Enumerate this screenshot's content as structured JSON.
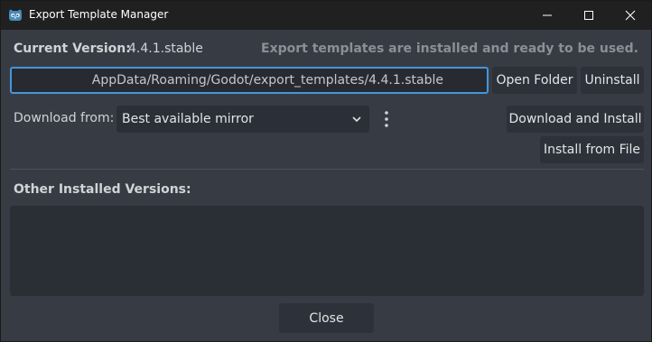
{
  "window": {
    "title": "Export Template Manager",
    "icons": {
      "app": "godot-icon",
      "minimize": "minimize-icon",
      "maximize": "maximize-icon",
      "close": "close-icon"
    }
  },
  "current": {
    "label": "Current Version:",
    "value": "4.4.1.stable",
    "status": "Export templates are installed and ready to be used."
  },
  "path": {
    "value": "AppData/Roaming/Godot/export_templates/4.4.1.stable"
  },
  "buttons": {
    "open_folder": "Open Folder",
    "uninstall": "Uninstall",
    "download_install": "Download and Install",
    "install_from_file": "Install from File",
    "close": "Close"
  },
  "download": {
    "label": "Download from:",
    "selected": "Best available mirror"
  },
  "other": {
    "label": "Other Installed Versions:",
    "items": []
  },
  "colors": {
    "accent": "#4596db",
    "background": "#373c44",
    "field": "#272b31"
  }
}
